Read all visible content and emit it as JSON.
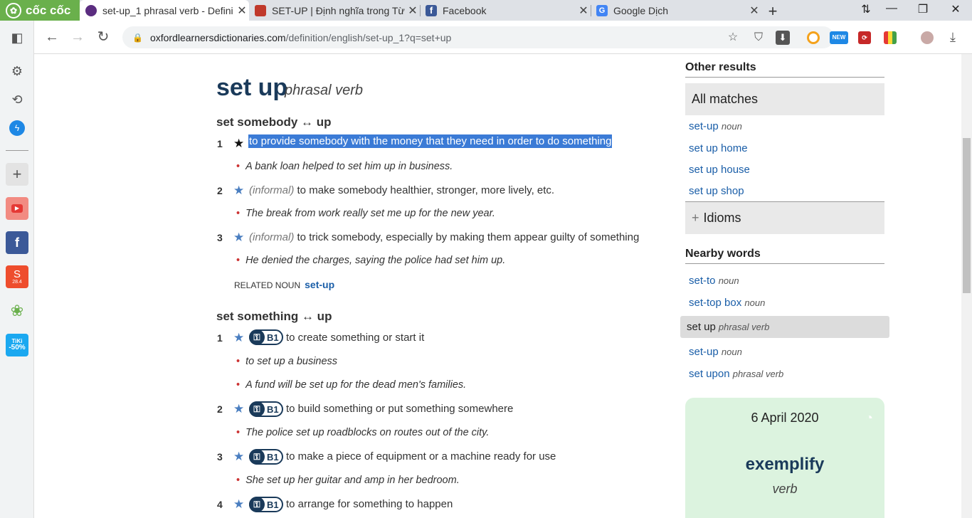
{
  "browser": {
    "brand": "cốc cốc",
    "tabs": [
      {
        "title": "set-up_1 phrasal verb - Defini",
        "active": true
      },
      {
        "title": "SET-UP | Định nghĩa trong Từ",
        "active": false
      },
      {
        "title": "Facebook",
        "active": false
      },
      {
        "title": "Google Dịch",
        "active": false
      }
    ],
    "url_host": "oxfordlearnersdictionaries.com",
    "url_path": "/definition/english/set-up_1?q=set+up",
    "new_badge": "NEW",
    "tiki_label": "TiKi",
    "tiki_discount": "-50%",
    "shopee_label": "28.4"
  },
  "entry": {
    "headword": "set up",
    "pos": "phrasal verb",
    "groups": [
      {
        "phrase": "set somebody ↔ up",
        "senses": [
          {
            "num": "1",
            "label": "",
            "def": "to provide somebody with the money that they need in order to do something",
            "examples": [
              "A bank loan helped to set him up in business."
            ]
          },
          {
            "num": "2",
            "label": "(informal)",
            "def": "to make somebody healthier, stronger, more lively, etc.",
            "examples": [
              "The break from work really set me up for the new year."
            ]
          },
          {
            "num": "3",
            "label": "(informal)",
            "def": "to trick somebody, especially by making them appear guilty of something",
            "examples": [
              "He denied the charges, saying the police had set him up."
            ]
          }
        ],
        "related_label": "RELATED NOUN",
        "related_link": "set-up"
      },
      {
        "phrase": "set something ↔ up",
        "senses": [
          {
            "num": "1",
            "level": "B1",
            "def": "to create something or start it",
            "examples": [
              "to set up a business",
              "A fund will be set up for the dead men's families."
            ]
          },
          {
            "num": "2",
            "level": "B1",
            "def": "to build something or put something somewhere",
            "examples": [
              "The police set up roadblocks on routes out of the city."
            ]
          },
          {
            "num": "3",
            "level": "B1",
            "def": "to make a piece of equipment or a machine ready for use",
            "examples": [
              "She set up her guitar and amp in her bedroom."
            ]
          },
          {
            "num": "4",
            "level": "B1",
            "def": "to arrange for something to happen",
            "examples": []
          }
        ]
      }
    ]
  },
  "sidebar_right": {
    "other_results_title": "Other results",
    "all_matches": "All matches",
    "other_results": [
      {
        "word": "set-up",
        "pos": "noun"
      },
      {
        "word": "set up home",
        "pos": ""
      },
      {
        "word": "set up house",
        "pos": ""
      },
      {
        "word": "set up shop",
        "pos": ""
      }
    ],
    "idioms": "Idioms",
    "nearby_title": "Nearby words",
    "nearby": [
      {
        "word": "set-to",
        "pos": "noun"
      },
      {
        "word": "set-top box",
        "pos": "noun"
      },
      {
        "word": "set up",
        "pos": "phrasal verb",
        "selected": true
      },
      {
        "word": "set-up",
        "pos": "noun"
      },
      {
        "word": "set upon",
        "pos": "phrasal verb"
      }
    ],
    "wotd": {
      "date": "6 April 2020",
      "word": "exemplify",
      "pos": "verb"
    }
  }
}
